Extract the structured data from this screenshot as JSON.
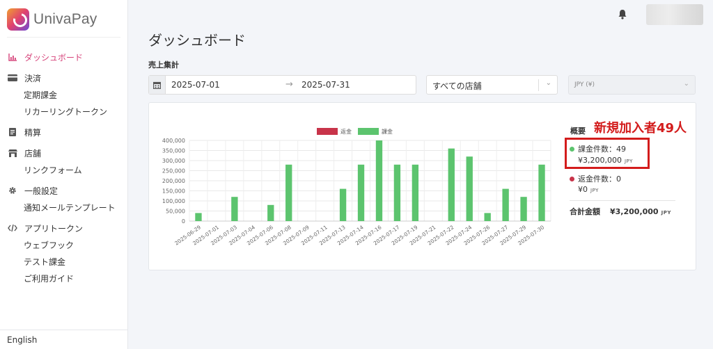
{
  "app": {
    "name": "UnivaPay"
  },
  "sidebar": {
    "items": [
      {
        "label": "ダッシュボード",
        "icon": "bar-chart-icon",
        "active": true,
        "children": []
      },
      {
        "label": "決済",
        "icon": "credit-card-icon",
        "children": [
          "定期課金",
          "リカーリングトークン"
        ]
      },
      {
        "label": "精算",
        "icon": "document-icon",
        "children": []
      },
      {
        "label": "店舗",
        "icon": "store-icon",
        "children": [
          "リンクフォーム"
        ]
      },
      {
        "label": "一般設定",
        "icon": "gear-icon",
        "children": [
          "通知メールテンプレート"
        ]
      },
      {
        "label": "アプリトークン",
        "icon": "code-icon",
        "children": [
          "ウェブフック",
          "テスト課金",
          "ご利用ガイド"
        ]
      }
    ],
    "language": "English"
  },
  "page": {
    "title": "ダッシュボード",
    "section": "売上集計"
  },
  "filters": {
    "date_start": "2025-07-01",
    "date_end": "2025-07-31",
    "store": "すべての店舗",
    "currency": "JPY (¥)"
  },
  "summary": {
    "title": "概要",
    "charge_label": "課金件数：49",
    "charge_amount": "¥3,200,000",
    "refund_label": "返金件数：0",
    "refund_amount": "¥0",
    "unit": "JPY",
    "total_label": "合計金額",
    "total_amount": "¥3,200,000",
    "annotation": "新規加入者49人"
  },
  "colors": {
    "accent": "#d6437a",
    "charge": "#5cc46e",
    "refund": "#c8344a",
    "annotation": "#d31c1c"
  },
  "chart_data": {
    "type": "bar",
    "legend": [
      "返金",
      "課金"
    ],
    "legend_position": "top",
    "categories": [
      "2025-06-29",
      "2025-07-01",
      "2025-07-03",
      "2025-07-04",
      "2025-07-06",
      "2025-07-08",
      "2025-07-09",
      "2025-07-11",
      "2025-07-13",
      "2025-07-14",
      "2025-07-16",
      "2025-07-17",
      "2025-07-19",
      "2025-07-21",
      "2025-07-22",
      "2025-07-24",
      "2025-07-26",
      "2025-07-27",
      "2025-07-29",
      "2025-07-30"
    ],
    "series": [
      {
        "name": "返金",
        "values": [
          0,
          0,
          0,
          0,
          0,
          0,
          0,
          0,
          0,
          0,
          0,
          0,
          0,
          0,
          0,
          0,
          0,
          0,
          0,
          0
        ]
      },
      {
        "name": "課金",
        "values": [
          40000,
          0,
          120000,
          0,
          80000,
          280000,
          0,
          0,
          160000,
          280000,
          400000,
          280000,
          280000,
          0,
          360000,
          320000,
          40000,
          160000,
          120000,
          280000
        ]
      }
    ],
    "y_ticks": [
      "0",
      "50,000",
      "100,000",
      "150,000",
      "200,000",
      "250,000",
      "300,000",
      "350,000",
      "400,000"
    ],
    "ylim": [
      0,
      400000
    ],
    "grid": true
  }
}
